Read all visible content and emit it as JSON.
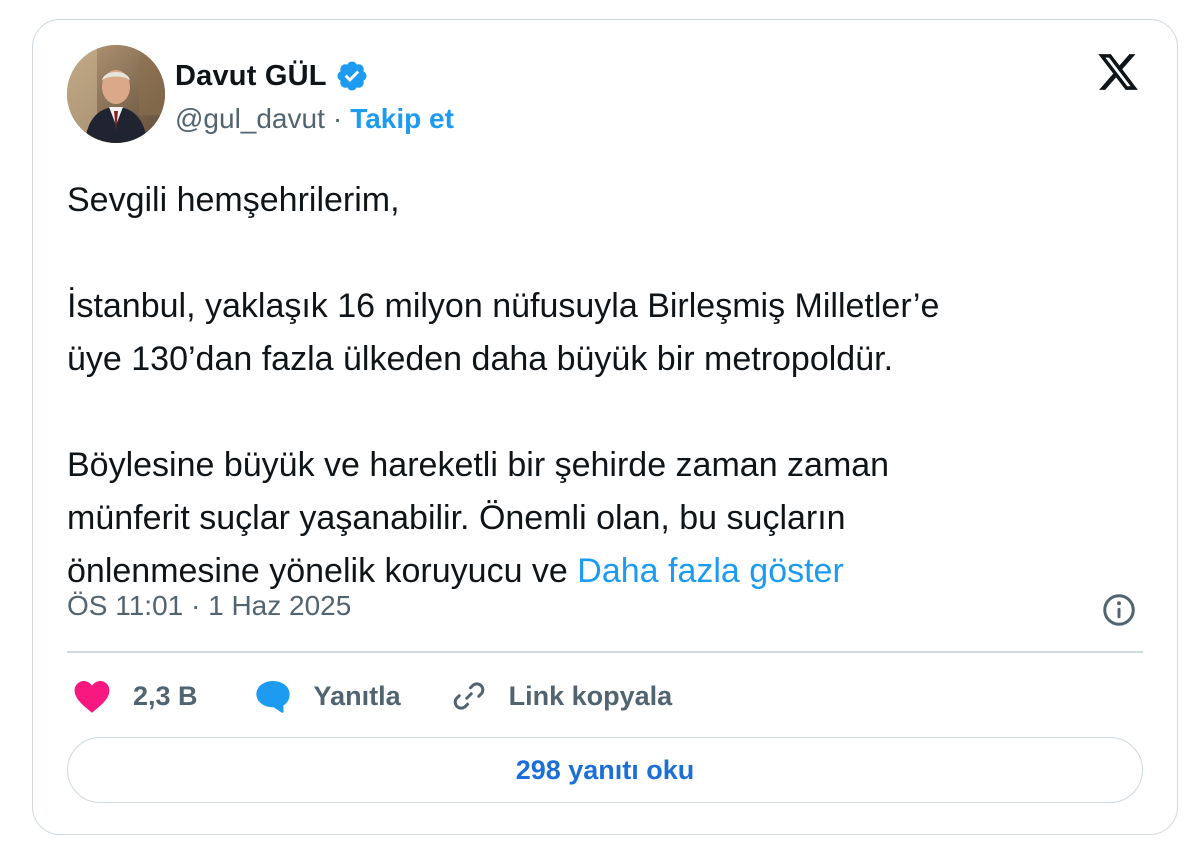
{
  "author": {
    "display_name": "Davut GÜL",
    "handle": "@gul_davut",
    "separator": "·",
    "follow_label": "Takip et",
    "verified_icon": "verified-badge-icon"
  },
  "tweet": {
    "lines": [
      "Sevgili hemşehrilerim,",
      "İstanbul, yaklaşık 16 milyon nüfusuyla Birleşmiş Milletler’e",
      "üye 130’dan fazla ülkeden daha büyük bir metropoldür.",
      "Böylesine büyük ve hareketli bir şehirde zaman zaman",
      "münferit suçlar yaşanabilir. Önemli olan, bu suçların",
      "önlenmesine yönelik koruyucu ve"
    ],
    "show_more": "Daha fazla göster",
    "timestamp": "ÖS 11:01 · 1 Haz 2025"
  },
  "actions": {
    "like_count": "2,3 B",
    "reply_label": "Yanıtla",
    "copy_link_label": "Link kopyala"
  },
  "read_replies_label": "298 yanıtı oku",
  "colors": {
    "accent": "#1d9bf0",
    "like": "#f91880",
    "secondary_text": "#536471",
    "border": "#cfd9de"
  }
}
